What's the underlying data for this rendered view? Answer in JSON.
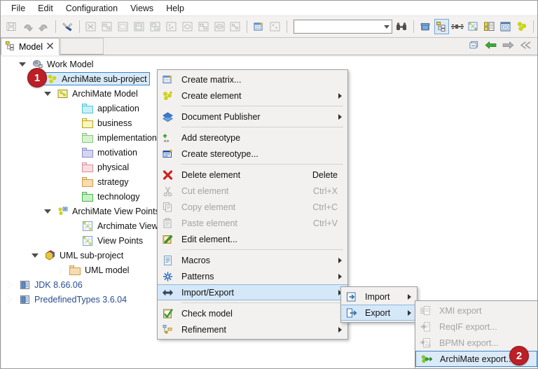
{
  "menubar": {
    "items": [
      {
        "label": "File",
        "name": "menu-file"
      },
      {
        "label": "Edit",
        "name": "menu-edit"
      },
      {
        "label": "Configuration",
        "name": "menu-configuration"
      },
      {
        "label": "Views",
        "name": "menu-views"
      },
      {
        "label": "Help",
        "name": "menu-help"
      }
    ]
  },
  "toolbar": {
    "combo_value": "",
    "combo_placeholder": "",
    "icons": [
      "save-icon",
      "undo-icon",
      "redo-icon",
      "tools-icon",
      "create-class-diagram-icon",
      "create-sequence-diagram-icon",
      "create-state-diagram-icon",
      "create-activity-diagram-icon",
      "create-component-diagram-icon",
      "create-deployment-diagram-icon",
      "create-usecase-diagram-icon",
      "create-object-diagram-icon",
      "create-package-diagram-icon",
      "create-profile-diagram-icon",
      "create-matrix-icon",
      "create-view-icon",
      "search-binoculars-icon",
      "trash-icon",
      "model-tree-icon",
      "link-icon",
      "matrix-view-icon",
      "table-view-icon",
      "grid-view-icon",
      "archimate-icon"
    ]
  },
  "tab": {
    "title": "Model",
    "icon": "model-tree-icon",
    "close_icon": "close-icon",
    "tools": [
      "minimize-icon",
      "back-arrow-icon",
      "forward-arrow-icon",
      "collapse-all-icon"
    ]
  },
  "tree": {
    "nodes": [
      {
        "label": "Work Model",
        "icon": "work-model-icon",
        "indent": 1,
        "twisty": "open",
        "selected": false,
        "blue": false
      },
      {
        "label": "ArchiMate sub-project",
        "icon": "archimate-group-icon",
        "indent": 2,
        "twisty": "open",
        "selected": true,
        "blue": false
      },
      {
        "label": "ArchiMate Model",
        "icon": "archimate-model-icon",
        "indent": 3,
        "twisty": "open",
        "selected": false,
        "blue": false
      },
      {
        "label": "application",
        "icon": "folder-cyan",
        "indent": 5,
        "twisty": "none",
        "selected": false,
        "blue": false
      },
      {
        "label": "business",
        "icon": "folder-yellow",
        "indent": 5,
        "twisty": "none",
        "selected": false,
        "blue": false
      },
      {
        "label": "implementation",
        "icon": "folder-palegreen",
        "indent": 5,
        "twisty": "none",
        "selected": false,
        "blue": false
      },
      {
        "label": "motivation",
        "icon": "folder-lavender",
        "indent": 5,
        "twisty": "none",
        "selected": false,
        "blue": false
      },
      {
        "label": "physical",
        "icon": "folder-pink",
        "indent": 5,
        "twisty": "none",
        "selected": false,
        "blue": false
      },
      {
        "label": "strategy",
        "icon": "folder-orange",
        "indent": 5,
        "twisty": "none",
        "selected": false,
        "blue": false
      },
      {
        "label": "technology",
        "icon": "folder-green",
        "indent": 5,
        "twisty": "none",
        "selected": false,
        "blue": false
      },
      {
        "label": "ArchiMate View Points",
        "icon": "archimate-views-icon",
        "indent": 3,
        "twisty": "open",
        "selected": false,
        "blue": false
      },
      {
        "label": "Archimate Views",
        "icon": "view-icon",
        "indent": 5,
        "twisty": "none",
        "selected": false,
        "blue": false
      },
      {
        "label": "View Points",
        "icon": "view-icon",
        "indent": 5,
        "twisty": "none",
        "selected": false,
        "blue": false
      },
      {
        "label": "UML sub-project",
        "icon": "uml-package-icon",
        "indent": 2,
        "twisty": "open",
        "selected": false,
        "blue": false
      },
      {
        "label": "UML model",
        "icon": "folder-orange",
        "indent": 4,
        "twisty": "closed",
        "selected": false,
        "blue": false
      },
      {
        "label": "JDK 8.66.06",
        "icon": "library-icon",
        "indent": 0,
        "twisty": "closed",
        "selected": false,
        "blue": true
      },
      {
        "label": "PredefinedTypes 3.6.04",
        "icon": "library-icon",
        "indent": 0,
        "twisty": "closed",
        "selected": false,
        "blue": true
      }
    ]
  },
  "context_menu": {
    "items": [
      {
        "label": "Create matrix...",
        "icon": "create-matrix-icon",
        "accel": "",
        "arrow": false,
        "disabled": false,
        "sep_after": false
      },
      {
        "label": "Create element",
        "icon": "create-element-icon",
        "accel": "",
        "arrow": true,
        "disabled": false,
        "sep_after": true
      },
      {
        "label": "Document Publisher",
        "icon": "document-publisher-icon",
        "accel": "",
        "arrow": true,
        "disabled": false,
        "sep_after": true
      },
      {
        "label": "Add stereotype",
        "icon": "add-stereotype-icon",
        "accel": "",
        "arrow": false,
        "disabled": false,
        "sep_after": false
      },
      {
        "label": "Create stereotype...",
        "icon": "create-stereotype-icon",
        "accel": "",
        "arrow": false,
        "disabled": false,
        "sep_after": true
      },
      {
        "label": "Delete element",
        "icon": "delete-icon",
        "accel": "Delete",
        "arrow": false,
        "disabled": false,
        "sep_after": false
      },
      {
        "label": "Cut element",
        "icon": "cut-icon",
        "accel": "Ctrl+X",
        "arrow": false,
        "disabled": true,
        "sep_after": false
      },
      {
        "label": "Copy element",
        "icon": "copy-icon",
        "accel": "Ctrl+C",
        "arrow": false,
        "disabled": true,
        "sep_after": false
      },
      {
        "label": "Paste element",
        "icon": "paste-icon",
        "accel": "Ctrl+V",
        "arrow": false,
        "disabled": true,
        "sep_after": false
      },
      {
        "label": "Edit element...",
        "icon": "edit-icon",
        "accel": "",
        "arrow": false,
        "disabled": false,
        "sep_after": true
      },
      {
        "label": "Macros",
        "icon": "macros-icon",
        "accel": "",
        "arrow": true,
        "disabled": false,
        "sep_after": false
      },
      {
        "label": "Patterns",
        "icon": "patterns-icon",
        "accel": "",
        "arrow": true,
        "disabled": false,
        "sep_after": false
      },
      {
        "label": "Import/Export",
        "icon": "import-export-icon",
        "accel": "",
        "arrow": true,
        "disabled": false,
        "sep_after": true,
        "highlighted": true
      },
      {
        "label": "Check model",
        "icon": "check-model-icon",
        "accel": "",
        "arrow": false,
        "disabled": false,
        "sep_after": false
      },
      {
        "label": "Refinement",
        "icon": "refinement-icon",
        "accel": "",
        "arrow": true,
        "disabled": false,
        "sep_after": false
      }
    ]
  },
  "import_export_menu": {
    "items": [
      {
        "label": "Import",
        "icon": "import-icon",
        "arrow": true,
        "highlighted": false
      },
      {
        "label": "Export",
        "icon": "export-icon",
        "arrow": true,
        "highlighted": true
      }
    ]
  },
  "export_menu": {
    "items": [
      {
        "label": "XMI export",
        "icon": "xmi-export-icon",
        "disabled": true,
        "highlighted": false
      },
      {
        "label": "ReqIF export...",
        "icon": "reqif-export-icon",
        "disabled": true,
        "highlighted": false
      },
      {
        "label": "BPMN export...",
        "icon": "bpmn-export-icon",
        "disabled": true,
        "highlighted": false
      },
      {
        "label": "ArchiMate export...",
        "icon": "archimate-export-icon",
        "disabled": false,
        "highlighted": true
      }
    ]
  },
  "badges": [
    {
      "label": "1",
      "name": "step-badge-1"
    },
    {
      "label": "2",
      "name": "step-badge-2"
    }
  ],
  "colors": {
    "badge_red": "#bc1f26",
    "selection_blue": "#d8eaf8",
    "selection_border": "#3c86c8",
    "menu_bg": "#f2f1ef",
    "archimate_yellow": "#cdd41a",
    "link_blue": "#2a4c8f"
  }
}
